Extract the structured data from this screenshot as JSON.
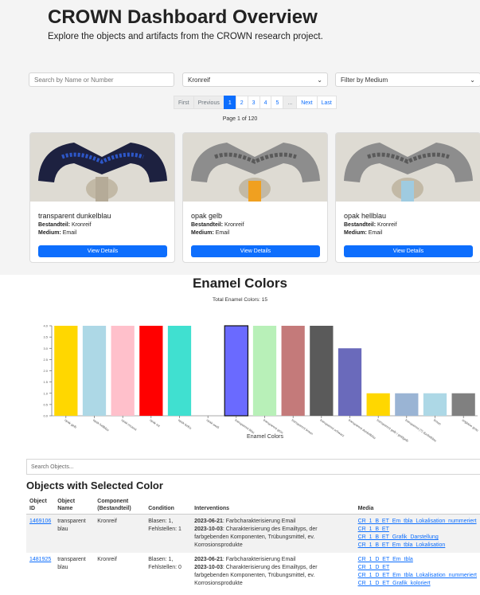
{
  "header": {
    "title": "CROWN Dashboard Overview",
    "subtitle": "Explore the objects and artifacts from the CROWN research project."
  },
  "filters": {
    "search_placeholder": "Search by Name or Number",
    "component_selected": "Kronreif",
    "medium_placeholder": "Filter by Medium"
  },
  "pagination": {
    "first": "First",
    "previous": "Previous",
    "pages": [
      "1",
      "2",
      "3",
      "4",
      "5"
    ],
    "ellipsis": "...",
    "next": "Next",
    "last": "Last",
    "info": "Page 1 of 120",
    "current_page": 1
  },
  "cards": [
    {
      "name": "transparent dunkelblau",
      "component_label": "Bestandteil:",
      "component": "Kronreif",
      "medium_label": "Medium:",
      "medium": "Email",
      "button": "View Details"
    },
    {
      "name": "opak gelb",
      "component_label": "Bestandteil:",
      "component": "Kronreif",
      "medium_label": "Medium:",
      "medium": "Email",
      "button": "View Details"
    },
    {
      "name": "opak hellblau",
      "component_label": "Bestandteil:",
      "component": "Kronreif",
      "medium_label": "Medium:",
      "medium": "Email",
      "button": "View Details"
    }
  ],
  "chart_section": {
    "title": "Enamel Colors",
    "subtitle": "Total Enamel Colors: 15"
  },
  "chart_data": {
    "type": "bar",
    "title": "",
    "xlabel": "Enamel Colors",
    "ylabel": "",
    "ylim": [
      0,
      4.0
    ],
    "yticks": [
      "0.0",
      "0.5",
      "1.0",
      "1.5",
      "2.0",
      "2.5",
      "3.0",
      "3.5",
      "4.0"
    ],
    "categories": [
      "opak gelb",
      "opak hellblau",
      "opak rosarot",
      "opak rot",
      "opak türkis",
      "opak weiß",
      "transparent blau",
      "transparent grün",
      "transparent braun",
      "transparent schwarz",
      "transparent dunkelblau",
      "transparent gelb / goldgelb",
      "transparent (?) dunkelblau",
      "braun",
      "anglaise grau"
    ],
    "values": [
      4,
      4,
      4,
      4,
      4,
      0,
      4,
      4,
      4,
      4,
      3,
      1,
      1,
      1,
      1
    ],
    "colors": [
      "#ffd700",
      "#add8e6",
      "#ffc0cb",
      "#ff0000",
      "#40e0d0",
      "#ffffff",
      "#6a6aff",
      "#b8f0b8",
      "#c47a7a",
      "#5a5a5a",
      "#6a6abb",
      "#ffd700",
      "#9ab4d4",
      "#add8e6",
      "#808080"
    ],
    "highlighted": "transparent blau",
    "grid": false
  },
  "objects": {
    "search_placeholder": "Search Objects...",
    "title": "Objects with Selected Color",
    "columns": [
      "Object ID",
      "Object Name",
      "Component (Bestandteil)",
      "Condition",
      "Interventions",
      "Media"
    ],
    "rows": [
      {
        "id": "1469106",
        "name": "transparent blau",
        "component": "Kronreif",
        "condition": "Blasen: 1, Fehlstellen: 1",
        "interventions": [
          {
            "date": "2023-06-21",
            "text": "Farbcharakterisierung Email"
          },
          {
            "date": "2023-10-03",
            "text": "Charakterisierung des Emailtyps, der farbgebenden Komponenten, Trübungsmittel, ev. Korrosionsprodukte"
          }
        ],
        "media": [
          "CR_1_B_ET_Em_tbla_Lokalisation_nummeriert",
          "CR_1_B_ET",
          "CR_1_B_ET_Grafik_Darstellung",
          "CR_1_B_ET_Em_tbla_Lokalisation"
        ]
      },
      {
        "id": "1481925",
        "name": "transparent blau",
        "component": "Kronreif",
        "condition": "Blasen: 1, Fehlstellen: 0",
        "interventions": [
          {
            "date": "2023-06-21",
            "text": "Farbcharakterisierung Email"
          },
          {
            "date": "2023-10-03",
            "text": "Charakterisierung des Emailtyps, der farbgebenden Komponenten, Trübungsmittel, ev. Korrosionsprodukte"
          }
        ],
        "media": [
          "CR_1_D_ET_Em_tbla",
          "CR_1_D_ET",
          "CR_1_D_ET_Em_tbla_Lokalisation_nummeriert",
          "CR_1_D_ET_Grafik_koloriert"
        ]
      }
    ]
  }
}
